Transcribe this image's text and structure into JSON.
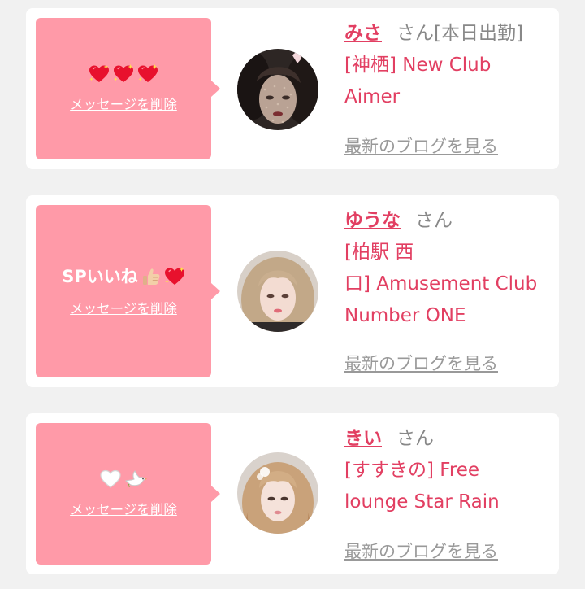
{
  "colors": {
    "page_background": "#f1f1f1",
    "card_background": "#ffffff",
    "bubble_pink": "#ff9aa8",
    "name_pink": "#e23f62",
    "muted_gray": "#888888"
  },
  "cards": [
    {
      "message_text": "",
      "message_icons": [
        "sparkling-heart-icon",
        "sparkling-heart-icon",
        "sparkling-heart-icon"
      ],
      "delete_label": "メッセージを削除",
      "name": "みさ",
      "honorific": "さん",
      "status": "[本日出勤]",
      "shop_lines": [
        "[神栖] New Club",
        "Aimer"
      ],
      "blog_link": "最新のブログを見る"
    },
    {
      "message_text": "SPいいね",
      "message_icons": [
        "thumbs-up-icon",
        "sparkling-heart-icon"
      ],
      "delete_label": "メッセージを削除",
      "name": "ゆうな",
      "honorific": "さん",
      "status": "",
      "shop_lines": [
        "[柏駅 西",
        "口] Amusement Club",
        "Number ONE"
      ],
      "blog_link": "最新のブログを見る"
    },
    {
      "message_text": "",
      "message_icons": [
        "white-heart-icon",
        "dove-icon"
      ],
      "delete_label": "メッセージを削除",
      "name": "きい",
      "honorific": "さん",
      "status": "",
      "shop_lines": [
        "[すすきの] Free",
        "lounge Star Rain"
      ],
      "blog_link": "最新のブログを見る"
    }
  ]
}
